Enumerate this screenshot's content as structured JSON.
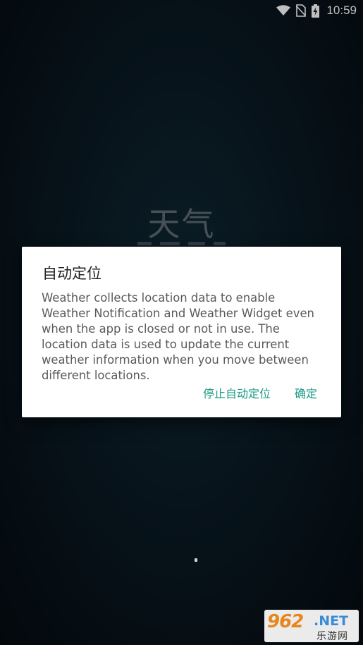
{
  "status_bar": {
    "time": "10:59",
    "icons": [
      "wifi-icon",
      "no-sim-icon",
      "battery-charging-icon"
    ]
  },
  "app": {
    "title": "天气"
  },
  "dialog": {
    "title": "自动定位",
    "message": "Weather collects location data to enable Weather Notification and Weather Widget even when the app is closed or not in use. The location data is used to update the current weather information when you move between different locations.",
    "buttons": {
      "stop_auto_locate": "停止自动定位",
      "confirm": "确定"
    },
    "accent_color": "#1b9a86"
  },
  "watermark": {
    "logo": "962",
    "net": ".NET",
    "subtitle": "乐游网"
  }
}
